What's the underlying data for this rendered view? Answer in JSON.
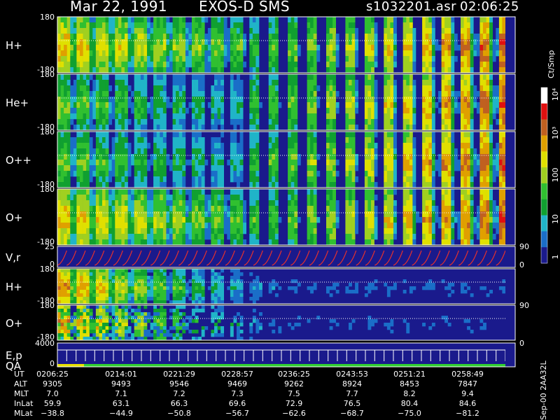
{
  "header": {
    "date": "Mar 22, 1991",
    "instrument": "EXOS-D SMS",
    "file": "s1032201.asr",
    "time": "02:06:25"
  },
  "colors": {
    "bg_empty": "#1a1a8c",
    "palette": [
      "#1a1a8c",
      "#1a6ec8",
      "#20b4c8",
      "#10a030",
      "#30c030",
      "#a0d020",
      "#e0e000",
      "#e0a000",
      "#c06020",
      "#e01010",
      "#ffffff"
    ],
    "trace": "#e03030"
  },
  "chart_data": [
    {
      "type": "heatmap",
      "panel_label": "H+",
      "ylim": [
        -180,
        180
      ],
      "yticks": [
        "180",
        "-180"
      ],
      "pattern": "spin_bands_dense_then_arcs"
    },
    {
      "type": "heatmap",
      "panel_label": "He+",
      "ylim": [
        -180,
        180
      ],
      "yticks": [
        "180",
        "-180"
      ],
      "pattern": "spin_bands_then_arcs"
    },
    {
      "type": "heatmap",
      "panel_label": "O++",
      "ylim": [
        -180,
        180
      ],
      "yticks": [
        "180",
        "-180"
      ],
      "pattern": "spin_bands_then_arcs"
    },
    {
      "type": "heatmap",
      "panel_label": "O+",
      "ylim": [
        -180,
        180
      ],
      "yticks": [
        "180",
        "-180"
      ],
      "pattern": "spin_bands_dense_then_arcs"
    },
    {
      "type": "line",
      "panel_label": "V,r",
      "ylim": [
        0,
        25
      ],
      "yticks": [
        "25",
        "0"
      ],
      "right_ticks": [
        "90",
        "0"
      ],
      "pattern": "sawtooth"
    },
    {
      "type": "heatmap",
      "panel_label": "H+",
      "ylim": [
        -180,
        180
      ],
      "yticks": [
        "180",
        "-180"
      ],
      "pattern": "fading_bands"
    },
    {
      "type": "heatmap",
      "panel_label": "O+",
      "ylim": [
        -180,
        180
      ],
      "yticks": [
        "180",
        "-180"
      ],
      "right_ticks": [
        "90"
      ],
      "pattern": "fading_bands_sparse"
    },
    {
      "type": "line",
      "panel_label": "E,p",
      "panel_label2": "QA",
      "ylim": [
        0,
        4000
      ],
      "yticks": [
        "4000",
        "0"
      ],
      "right_ticks": [
        "0"
      ],
      "pattern": "steps"
    }
  ],
  "colorbar": {
    "title": "Ct/Smp",
    "ticks": [
      "10⁴",
      "10³",
      "100",
      "10",
      "1"
    ]
  },
  "ut_table": {
    "rows": [
      {
        "label": "UT",
        "values": [
          "0206:25",
          "0214:01",
          "0221:29",
          "0228:57",
          "0236:25",
          "0243:53",
          "0251:21",
          "0258:49"
        ]
      },
      {
        "label": "ALT",
        "values": [
          "9305",
          "9493",
          "9546",
          "9469",
          "9262",
          "8924",
          "8453",
          "7847"
        ]
      },
      {
        "label": "MLT",
        "values": [
          "7.0",
          "7.1",
          "7.2",
          "7.3",
          "7.5",
          "7.7",
          "8.2",
          "9.4"
        ]
      },
      {
        "label": "InLat",
        "values": [
          "59.9",
          "63.1",
          "66.3",
          "69.6",
          "72.9",
          "76.5",
          "80.4",
          "84.6"
        ]
      },
      {
        "label": "MLat",
        "values": [
          "−38.8",
          "−44.9",
          "−50.8",
          "−56.7",
          "−62.6",
          "−68.7",
          "−75.0",
          "−81.2"
        ]
      }
    ]
  },
  "footer": "Sep-00  2AA32L"
}
